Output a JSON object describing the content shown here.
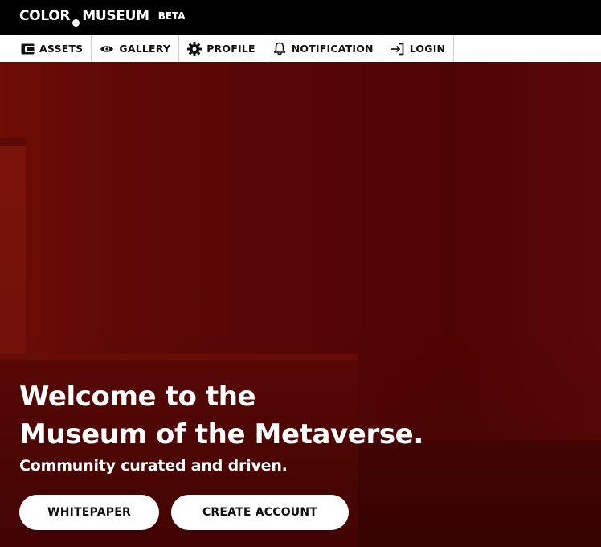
{
  "header": {
    "logo_left": "COLOR",
    "logo_right": "MUSEUM",
    "badge": "BETA"
  },
  "nav": {
    "items": [
      {
        "label": "ASSETS",
        "icon": "wallet-icon"
      },
      {
        "label": "GALLERY",
        "icon": "eye-icon"
      },
      {
        "label": "PROFILE",
        "icon": "gear-icon"
      },
      {
        "label": "NOTIFICATION",
        "icon": "bell-icon"
      },
      {
        "label": "LOGIN",
        "icon": "login-icon"
      }
    ]
  },
  "hero": {
    "headline_line1": "Welcome to the",
    "headline_line2": "Museum of the Metaverse.",
    "subline": "Community curated and driven.",
    "buttons": {
      "whitepaper": "WHITEPAPER",
      "create_account": "CREATE ACCOUNT"
    },
    "background_color": "#5a0707"
  },
  "colors": {
    "topbar": "#000000",
    "navbar": "#ffffff",
    "text_light": "#ffffff",
    "text_dark": "#111111"
  }
}
